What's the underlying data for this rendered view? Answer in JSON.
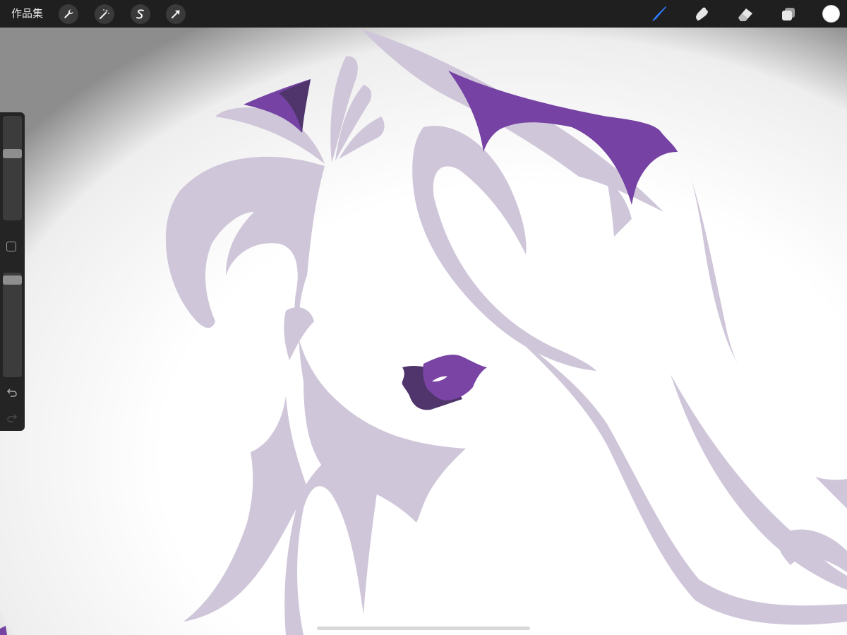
{
  "toolbar": {
    "gallery_label": "作品集",
    "left_tools": [
      {
        "name": "actions",
        "icon": "wrench-icon"
      },
      {
        "name": "adjustments",
        "icon": "magic-wand-icon"
      },
      {
        "name": "selection",
        "icon": "selection-s-icon"
      },
      {
        "name": "transform",
        "icon": "arrow-cursor-icon"
      }
    ],
    "right_tools": [
      {
        "name": "brush",
        "icon": "brush-icon",
        "active": true
      },
      {
        "name": "smudge",
        "icon": "smudge-finger-icon"
      },
      {
        "name": "eraser",
        "icon": "eraser-icon"
      },
      {
        "name": "layers",
        "icon": "layers-icon"
      }
    ],
    "current_color": "#ffffff",
    "active_tool_color": "#2f7bff"
  },
  "sidebar": {
    "brush_size_level": 0.65,
    "opacity_level": 0.97,
    "modify_icon": "square-icon",
    "undo_icon": "undo-arrow-icon",
    "redo_icon": "redo-arrow-icon"
  },
  "canvas": {
    "hair_color": "#cfc6d9",
    "accent_purple": "#7642a3",
    "dark_purple": "#4f356b"
  }
}
